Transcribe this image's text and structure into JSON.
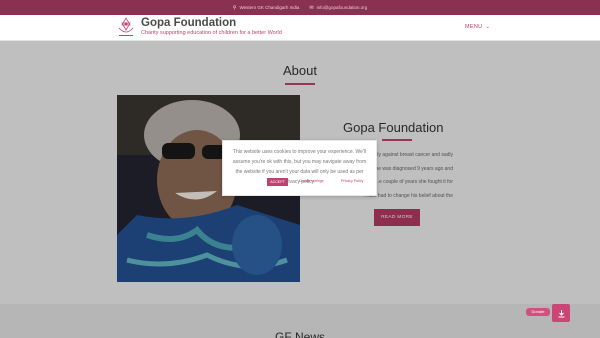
{
  "topbar": {
    "location_icon": "map-pin-icon",
    "location": "Western GK Chandigarh India",
    "email_icon": "envelope-icon",
    "email": "info@gopafoundation.org"
  },
  "header": {
    "title": "Gopa Foundation",
    "tagline": "Charity supporting education of children for a better World",
    "menu_label": "MENU",
    "menu_icon": "chevron-down-icon"
  },
  "about": {
    "title": "About",
    "foundation_title": "Gopa Foundation",
    "body_lines": [
      "...ely against breast cancer and sadly",
      "...20. She was diagnosed 9 years ago and",
      "...e couple of years she fought it for",
      "...tant had to change his belief about the"
    ],
    "read_more_label": "READ MORE"
  },
  "cookie_notice": {
    "text": "This website uses cookies to improve your experience. We'll assume you're ok with this, but you may navigate away from the website if you aren't your data will only be used as per privacy policy.",
    "accept_label": "ACCEPT",
    "settings_label": "Cookie settings",
    "privacy_label": "Privacy Policy"
  },
  "news": {
    "title": "GF News"
  },
  "donate": {
    "label": "Donate",
    "icon": "download-icon"
  },
  "colors": {
    "brand": "#8a3152",
    "accent": "#c0436f",
    "button": "#b13a63"
  }
}
